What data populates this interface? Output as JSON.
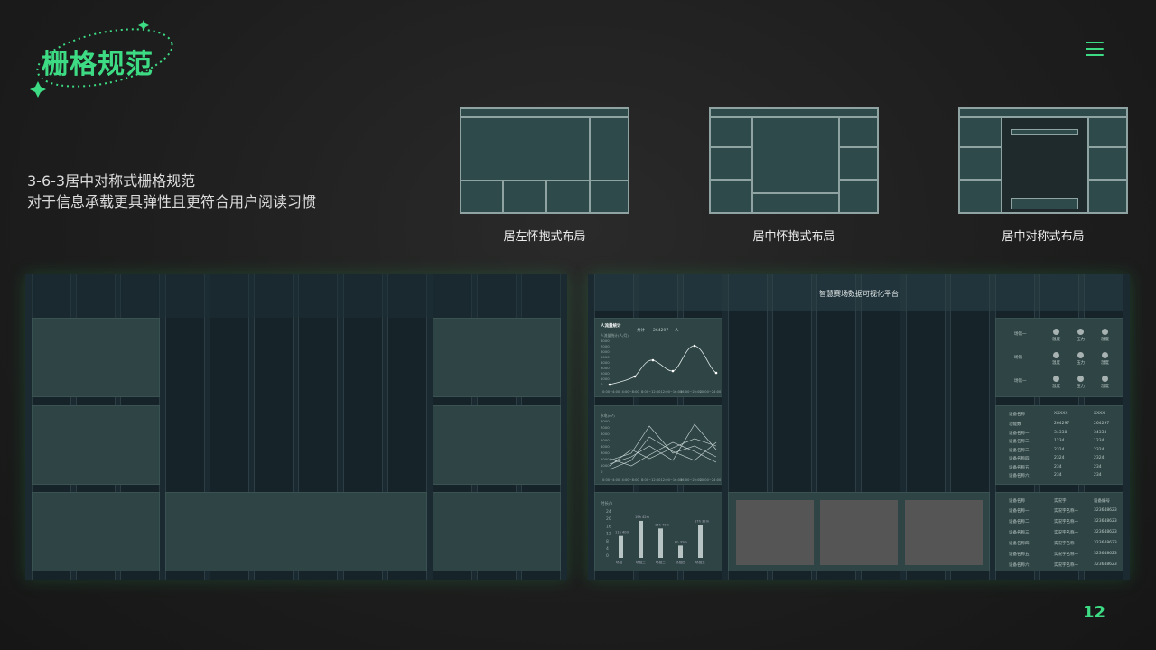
{
  "header": {
    "logo_text": "栅格规范",
    "brand_color": "#3ddc84"
  },
  "description": {
    "line1": "3-6-3居中对称式栅格规范",
    "line2": "对于信息承载更具弹性且更符合用户阅读习惯"
  },
  "layouts": [
    {
      "caption": "居左怀抱式布局"
    },
    {
      "caption": "居中怀抱式布局"
    },
    {
      "caption": "居中对称式布局"
    }
  ],
  "dashboard": {
    "title": "智慧赛场数据可视化平台",
    "chart1": {
      "title": "人流量统计",
      "stat_label": "共计",
      "stat_value": "264297",
      "stat_unit": "人",
      "ylabel": "人流量统计(人/月)",
      "yticks": [
        "8000",
        "7000",
        "6000",
        "5000",
        "4000",
        "3000",
        "2000",
        "1000",
        "0"
      ],
      "xticks": [
        "0:00~4:00",
        "4:00~8:00",
        "8:00~12:00",
        "12:00~16:00",
        "16:00~20:00",
        "20:00~24:00"
      ]
    },
    "chart2": {
      "ylabel": "水电(m³)",
      "yticks": [
        "8000",
        "7000",
        "6000",
        "5000",
        "4000",
        "3000",
        "2000",
        "1000",
        "0"
      ],
      "xticks": [
        "0:00~4:00",
        "4:00~8:00",
        "8:00~12:00",
        "12:00~16:00",
        "16:00~20:00",
        "20:00~24:00"
      ]
    },
    "chart3": {
      "ylabel": "时长/h",
      "yticks": [
        "24",
        "20",
        "16",
        "12",
        "8",
        "4",
        "0"
      ],
      "bars": [
        {
          "label": "11h 40m",
          "cat": "场馆一",
          "value": 11.67
        },
        {
          "label": "19h 42m",
          "cat": "场馆二",
          "value": 19.7
        },
        {
          "label": "15h 40m",
          "cat": "场馆三",
          "value": 15.67
        },
        {
          "label": "6h 32m",
          "cat": "场馆四",
          "value": 6.53
        },
        {
          "label": "17h 32m",
          "cat": "场馆五",
          "value": 17.53
        }
      ]
    },
    "status_panel": {
      "rows": [
        "场馆一",
        "场馆一",
        "场馆一"
      ],
      "dot_labels": [
        "温度",
        "压力",
        "湿度"
      ]
    },
    "table1": {
      "headers": [
        "设备名称",
        "XXXXX",
        "XXXX"
      ],
      "rows": [
        [
          "功能数",
          "264297",
          "264297"
        ],
        [
          "设备名称一",
          "34338",
          "34338"
        ],
        [
          "设备名称二",
          "1234",
          "1234"
        ],
        [
          "设备名称三",
          "2324",
          "2324"
        ],
        [
          "设备名称四",
          "2324",
          "2324"
        ],
        [
          "设备名称五",
          "234",
          "234"
        ],
        [
          "设备名称六",
          "234",
          "234"
        ]
      ]
    },
    "table2": {
      "headers": [
        "设备名称",
        "实况字",
        "设备编号"
      ],
      "rows": [
        [
          "设备名称一",
          "实况字名称一",
          "323648623"
        ],
        [
          "设备名称二",
          "实况字名称一",
          "323648623"
        ],
        [
          "设备名称三",
          "实况字名称一",
          "323648623"
        ],
        [
          "设备名称四",
          "实况字名称一",
          "323648623"
        ],
        [
          "设备名称五",
          "实况字名称一",
          "323648623"
        ],
        [
          "设备名称六",
          "实况字名称一",
          "323648623"
        ]
      ]
    }
  },
  "page_number": "12"
}
